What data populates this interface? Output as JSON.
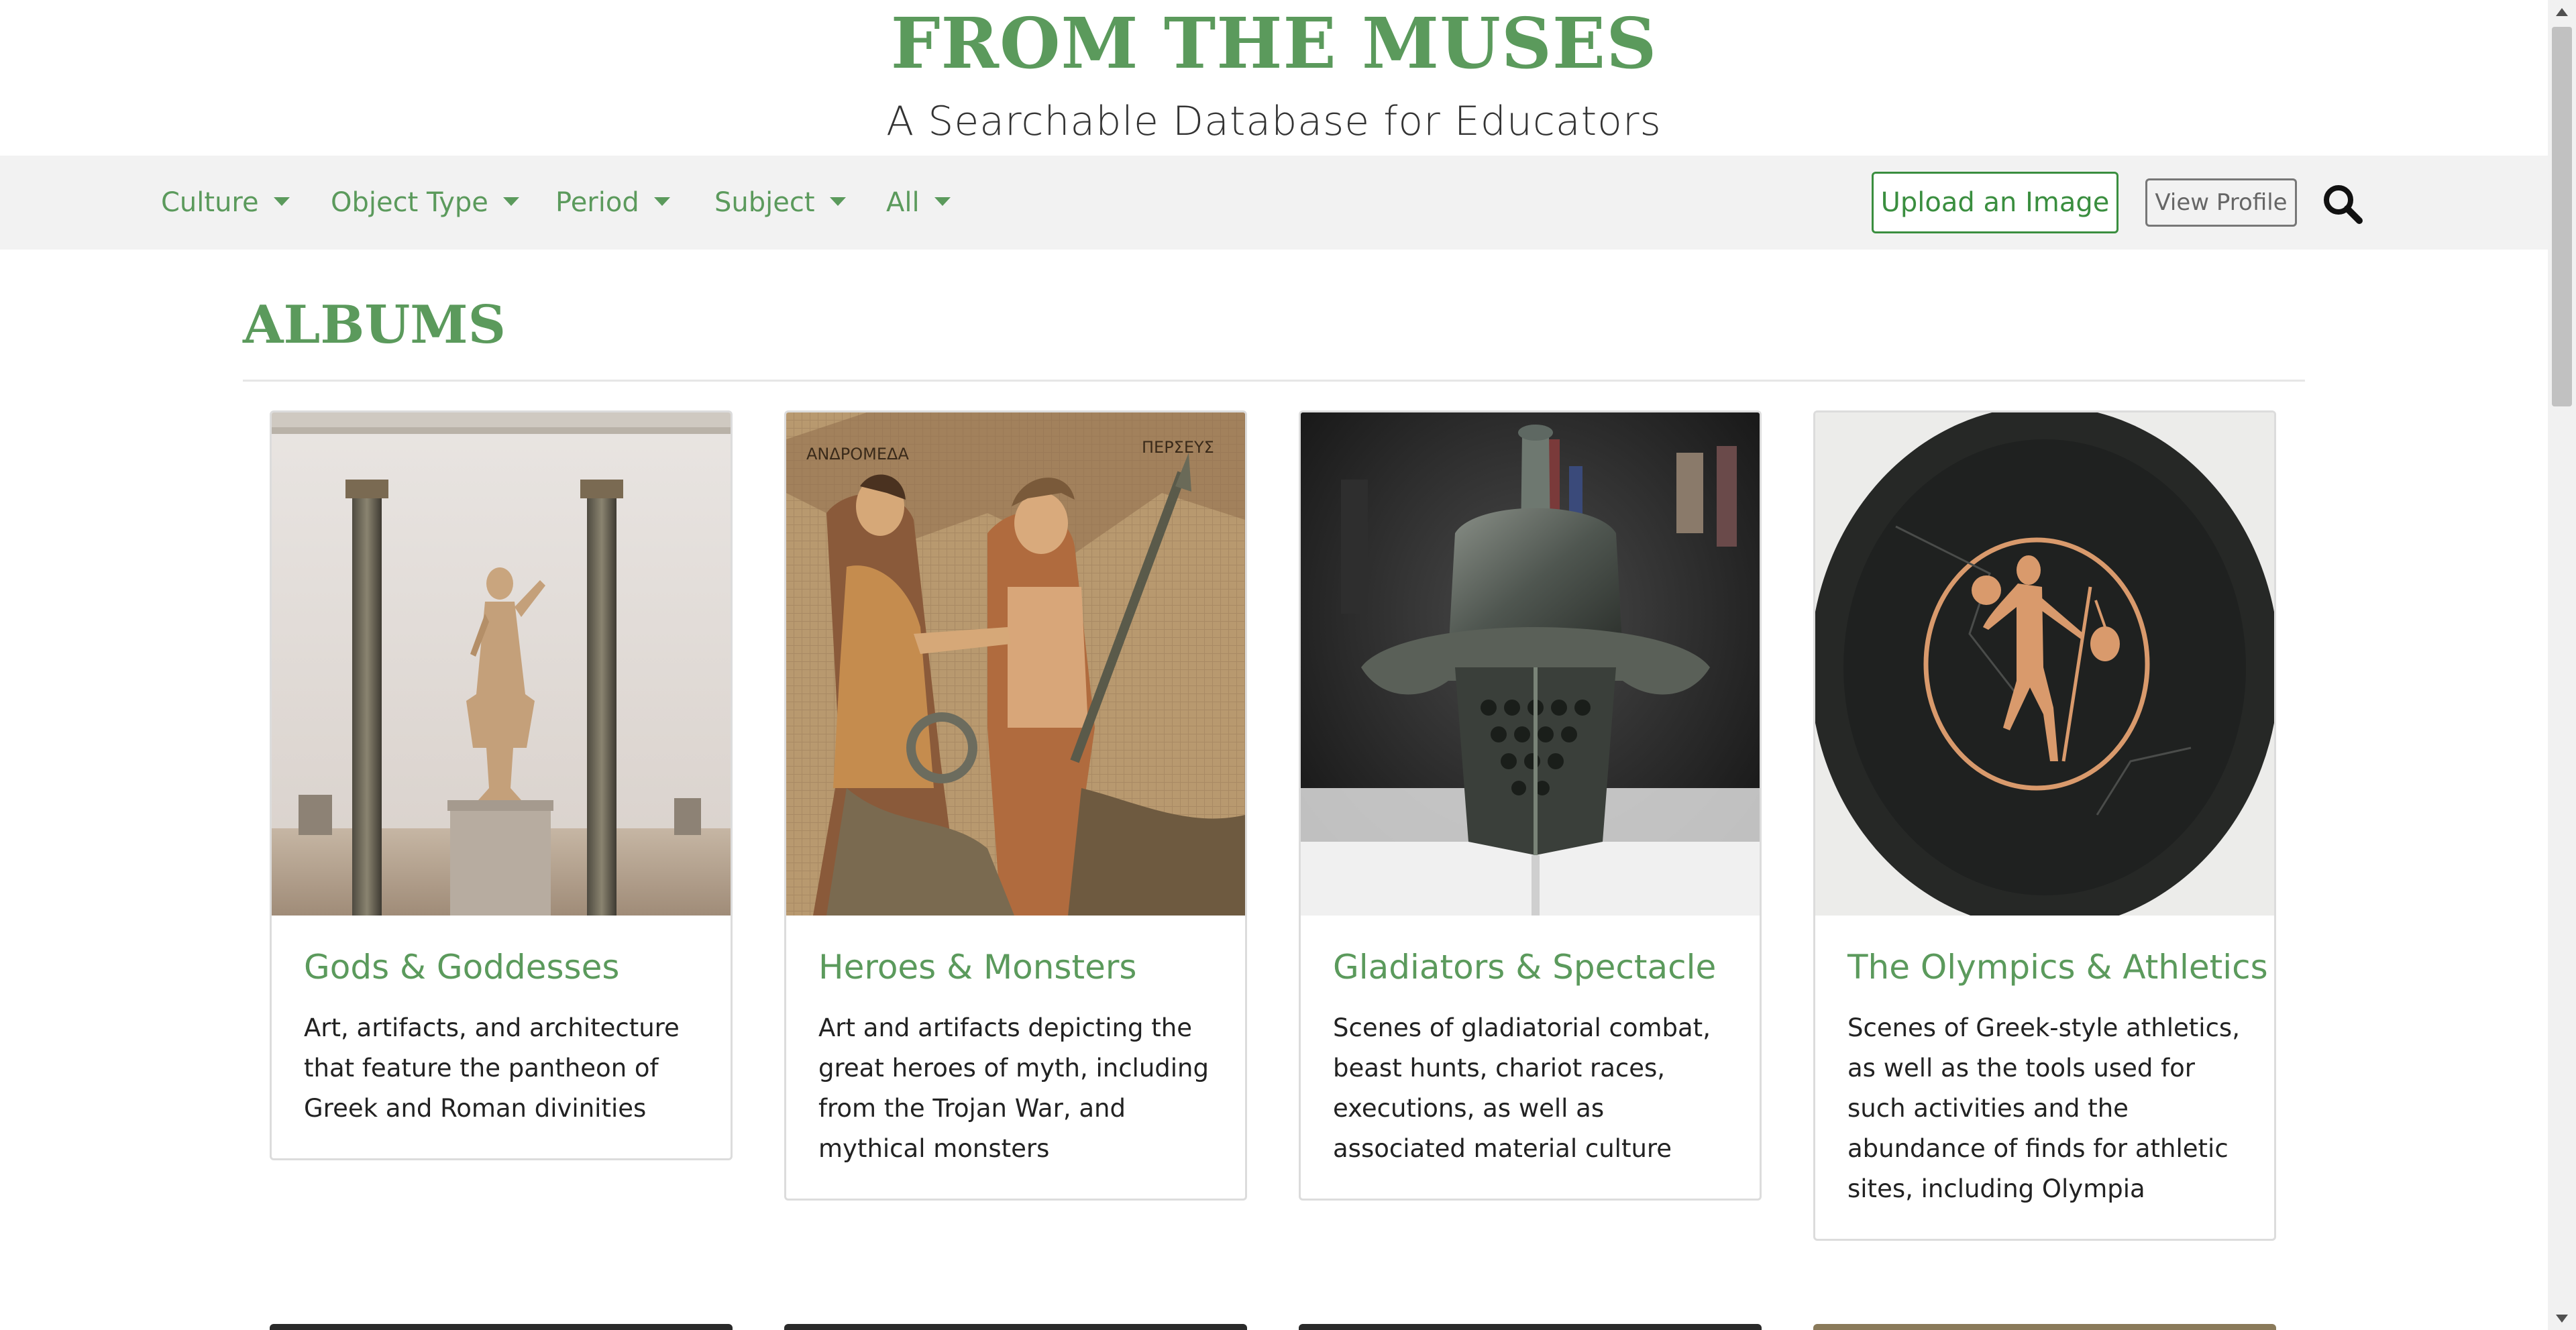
{
  "header": {
    "title": "FROM THE MUSES",
    "subtitle": "A Searchable Database for Educators"
  },
  "nav": {
    "menus": [
      {
        "label": "Culture"
      },
      {
        "label": "Object Type"
      },
      {
        "label": "Period"
      },
      {
        "label": "Subject"
      },
      {
        "label": "All"
      }
    ],
    "upload_label": "Upload an Image",
    "profile_label": "View Profile",
    "search_icon": "search-icon"
  },
  "albums": {
    "heading": "ALBUMS",
    "cards": [
      {
        "title": "Gods & Goddesses",
        "description": "Art, artifacts, and architecture that feature the pantheon of Greek and Roman divinities",
        "image": "marble-goddess-statue-between-columns"
      },
      {
        "title": "Heroes & Monsters",
        "description": "Art and artifacts depicting the great heroes of myth, including from the Trojan War, and mythical monsters",
        "image": "mosaic-perseus-andromeda",
        "image_inscriptions": [
          "ΑΝΔΡΟΜΕΔΑ",
          "ΠΕΡΣΕΥΣ"
        ]
      },
      {
        "title": "Gladiators & Spectacle",
        "description": "Scenes of gladiatorial combat, beast hunts, chariot races, executions, as well as associated material culture",
        "image": "bronze-gladiator-helmet"
      },
      {
        "title": "The Olympics & Athletics",
        "description": "Scenes of Greek-style athletics, as well as the tools used for such activities and the abundance of finds for athletic sites, including Olympia",
        "image": "red-figure-kylix-athlete"
      }
    ]
  },
  "colors": {
    "brand_green": "#5b9a5c",
    "button_green": "#3a8e3f",
    "nav_background": "#f2f2f2"
  }
}
